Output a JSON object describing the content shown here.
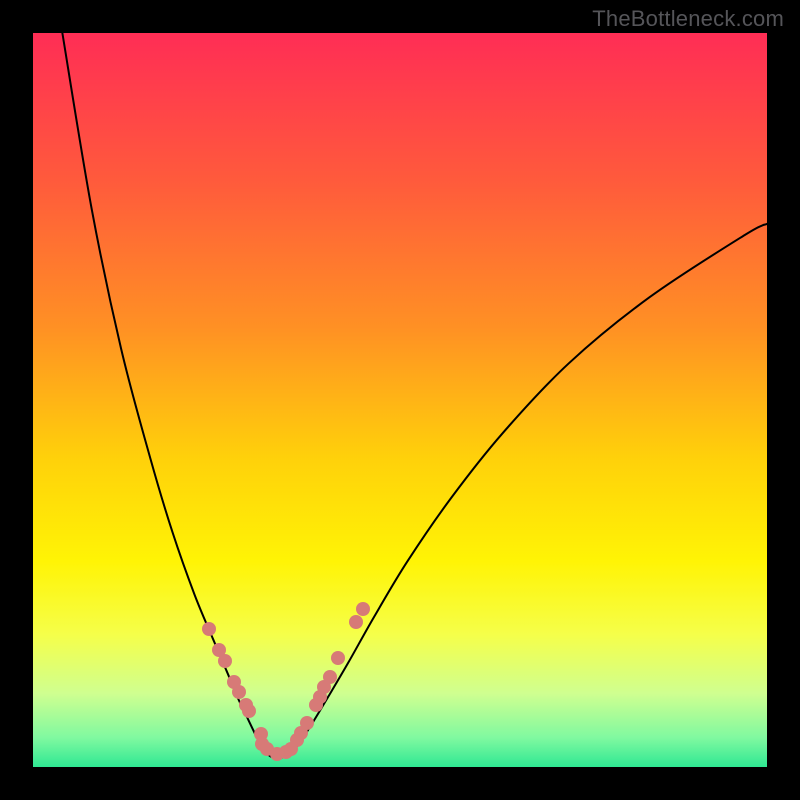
{
  "watermark": "TheBottleneck.com",
  "colors": {
    "frame": "#000000",
    "dot": "#D77A77",
    "curve": "#000000",
    "gradient_stops": [
      {
        "offset": 0,
        "color": "#FF2D55"
      },
      {
        "offset": 0.2,
        "color": "#FF5A3C"
      },
      {
        "offset": 0.4,
        "color": "#FF9024"
      },
      {
        "offset": 0.58,
        "color": "#FFD10A"
      },
      {
        "offset": 0.72,
        "color": "#FFF405"
      },
      {
        "offset": 0.82,
        "color": "#F5FF4A"
      },
      {
        "offset": 0.9,
        "color": "#CFFF90"
      },
      {
        "offset": 0.96,
        "color": "#80F9A0"
      },
      {
        "offset": 1.0,
        "color": "#2FE893"
      }
    ]
  },
  "chart_data": {
    "type": "line",
    "title": "",
    "xlabel": "",
    "ylabel": "",
    "xlim": [
      0,
      100
    ],
    "ylim": [
      0,
      100
    ],
    "note": "X and Y ranges are nominal (no visible axis ticks). Y is inverted so higher y-value appears lower on screen? No — values here are visual percentages from top-left of plot: y=0 is top, y=100 is bottom.",
    "series": [
      {
        "name": "left-branch",
        "x": [
          4,
          8,
          12,
          16,
          19,
          22,
          24.5,
          26.5,
          28,
          29.3,
          30.3,
          31.1
        ],
        "y": [
          0,
          24,
          43,
          58,
          68,
          76.5,
          82.5,
          87.2,
          90.8,
          93.5,
          95.6,
          97.2
        ]
      },
      {
        "name": "valley-floor",
        "x": [
          31.1,
          32,
          33,
          34.2,
          35.5
        ],
        "y": [
          97.2,
          98.3,
          98.8,
          98.6,
          97.8
        ]
      },
      {
        "name": "right-branch",
        "x": [
          35.5,
          36.6,
          38.2,
          40.3,
          43,
          46.5,
          51,
          57,
          64,
          73,
          84,
          97,
          100
        ],
        "y": [
          97.8,
          96.3,
          93.8,
          90.3,
          85.7,
          79.5,
          72,
          63.3,
          54.5,
          45,
          36,
          27.5,
          26
        ]
      }
    ],
    "marked_points": {
      "name": "highlighted-dots",
      "color": "#D77A77",
      "points": [
        {
          "x": 24.0,
          "y": 81.2
        },
        {
          "x": 25.4,
          "y": 84.1
        },
        {
          "x": 26.1,
          "y": 85.6
        },
        {
          "x": 27.4,
          "y": 88.4
        },
        {
          "x": 28.1,
          "y": 89.8
        },
        {
          "x": 29.0,
          "y": 91.6
        },
        {
          "x": 29.4,
          "y": 92.4
        },
        {
          "x": 31.0,
          "y": 95.5
        },
        {
          "x": 31.2,
          "y": 96.8
        },
        {
          "x": 31.9,
          "y": 97.6
        },
        {
          "x": 33.2,
          "y": 98.2
        },
        {
          "x": 34.5,
          "y": 98.0
        },
        {
          "x": 35.1,
          "y": 97.5
        },
        {
          "x": 36.0,
          "y": 96.3
        },
        {
          "x": 36.5,
          "y": 95.4
        },
        {
          "x": 37.3,
          "y": 94.0
        },
        {
          "x": 38.5,
          "y": 91.6
        },
        {
          "x": 39.1,
          "y": 90.4
        },
        {
          "x": 39.7,
          "y": 89.1
        },
        {
          "x": 40.4,
          "y": 87.7
        },
        {
          "x": 41.6,
          "y": 85.2
        },
        {
          "x": 44.0,
          "y": 80.3
        },
        {
          "x": 44.9,
          "y": 78.5
        }
      ]
    }
  }
}
